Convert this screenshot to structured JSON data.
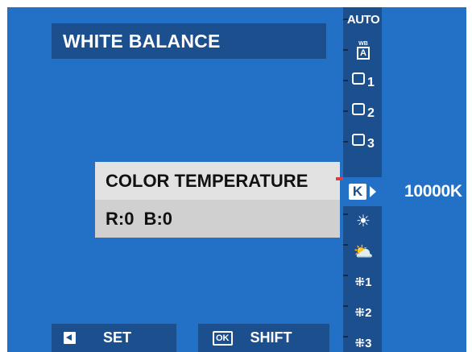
{
  "header": {
    "title": "WHITE BALANCE"
  },
  "selection": {
    "mode_label": "COLOR TEMPERATURE",
    "shift_text": "R:0  B:0"
  },
  "wb_modes": [
    {
      "name": "auto",
      "label": "AUTO",
      "icon": "auto-text"
    },
    {
      "name": "white-priority",
      "wb_top": "WB",
      "wb_box": "A",
      "icon": "wb-auto-white-icon"
    },
    {
      "name": "custom-1",
      "num": "1",
      "icon": "custom-wb-1-icon"
    },
    {
      "name": "custom-2",
      "num": "2",
      "icon": "custom-wb-2-icon"
    },
    {
      "name": "custom-3",
      "num": "3",
      "icon": "custom-wb-3-icon"
    },
    {
      "name": "kelvin",
      "label": "K",
      "icon": "kelvin-icon",
      "selected": true
    },
    {
      "name": "daylight",
      "glyph": "☀",
      "icon": "sun-icon"
    },
    {
      "name": "shade",
      "glyph": "⛅",
      "icon": "shade-icon"
    },
    {
      "name": "fluorescent-1",
      "glyph": "⁜1",
      "icon": "fluorescent-1-icon"
    },
    {
      "name": "fluorescent-2",
      "glyph": "⁜2",
      "icon": "fluorescent-2-icon"
    },
    {
      "name": "fluorescent-3",
      "glyph": "⁜3",
      "icon": "fluorescent-3-icon"
    }
  ],
  "kelvin_value": "10000K",
  "footer": {
    "set_label": "SET",
    "ok_icon_text": "OK",
    "shift_label": "SHIFT"
  },
  "colors": {
    "background": "#2271c6",
    "panel": "#1c4f8d",
    "selected_row": "#e2e2e2",
    "secondary_row": "#d0d0d0",
    "indicator": "#e23b3b"
  }
}
